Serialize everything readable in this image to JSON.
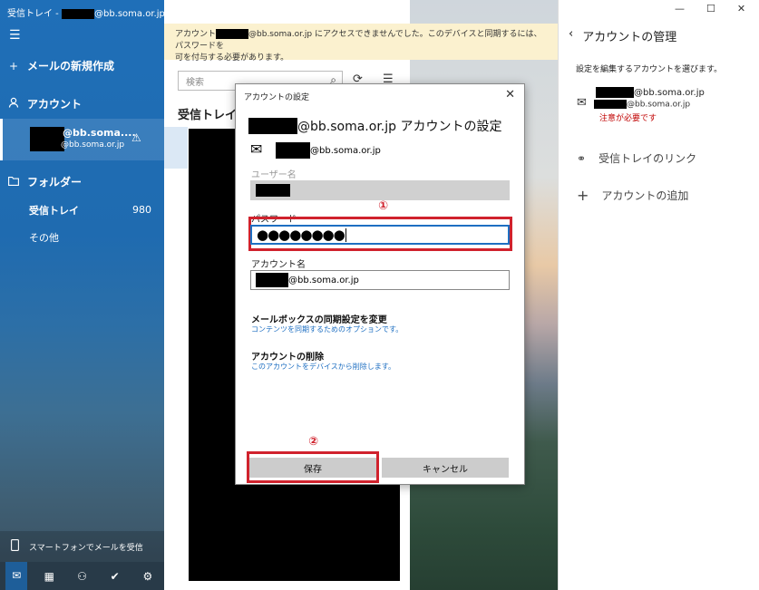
{
  "window": {
    "title_prefix": "受信トレイ - ",
    "title_suffix": "@bb.soma.or.jp",
    "controls": [
      "—",
      "☐",
      "✕"
    ]
  },
  "sidebar": {
    "hamburger": "☰",
    "new_mail": "メールの新規作成",
    "accounts_heading": "アカウント",
    "account": {
      "name": "@bb.soma....",
      "email": "@bb.soma.or.jp",
      "warn_icon": "⚠"
    },
    "folders_heading": "フォルダー",
    "folders": [
      {
        "label": "受信トレイ",
        "count": "980"
      },
      {
        "label": "その他",
        "count": ""
      }
    ],
    "phone": "スマートフォンでメールを受信",
    "bottom_icons": [
      "mail-icon",
      "calendar-icon",
      "people-icon",
      "todo-icon",
      "settings-icon"
    ]
  },
  "notice": {
    "text_before": "アカウント",
    "text_after": "@bb.soma.or.jp にアクセスできませんでした。このデバイスと同期するには、パスワードを",
    "line2": "可を付与する必要があります。"
  },
  "middle": {
    "search_placeholder": "検索",
    "inbox_title": "受信トレイ"
  },
  "right": {
    "title": "アカウントの管理",
    "subtitle": "設定を編集するアカウントを選びます。",
    "account_email1": "@bb.soma.or.jp",
    "account_email2": "@bb.soma.or.jp",
    "account_warning": "注意が必要です",
    "link_inbox": "受信トレイのリンク",
    "add_account": "アカウントの追加"
  },
  "dialog": {
    "title": "アカウントの設定",
    "close": "✕",
    "heading_domain": "@bb.soma.or.jp アカウントの設定",
    "email_domain": "@bb.soma.or.jp",
    "username_label": "ユーザー名",
    "password_label": "パスワード",
    "password_value": "●●●●●●●●",
    "account_name_label": "アカウント名",
    "account_name_value": "@bb.soma.or.jp",
    "sync_heading": "メールボックスの同期設定を変更",
    "sync_link": "コンテンツを同期するためのオプションです。",
    "delete_heading": "アカウントの削除",
    "delete_link": "このアカウントをデバイスから削除します。",
    "save": "保存",
    "cancel": "キャンセル",
    "marker1": "①",
    "marker2": "②"
  },
  "colors": {
    "accent": "#1e6fc2",
    "highlight_red": "#d0222d",
    "notice_bg": "#fbf1cf"
  }
}
